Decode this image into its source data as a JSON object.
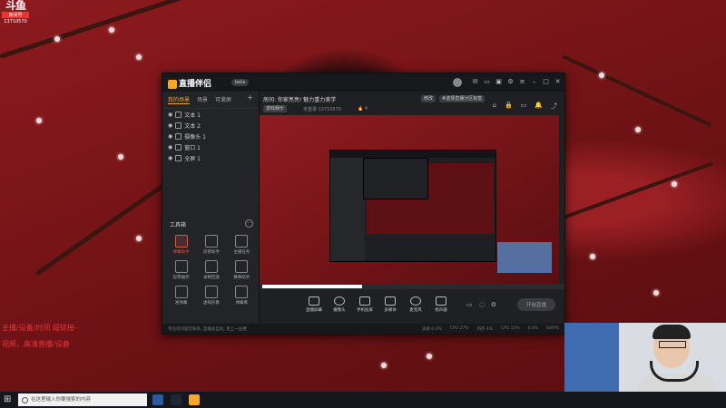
{
  "watermark": {
    "logo": "斗鱼",
    "tag": "房间号",
    "room": "13710570"
  },
  "overlay_red": {
    "line1": "主播/设备/时间 超链接-",
    "line2": "视频、高清直播/设备"
  },
  "app": {
    "title": "直播伴侣",
    "version_badge": "beta",
    "sidebar": {
      "tabs": [
        {
          "label": "我的场景"
        },
        {
          "label": "场景"
        },
        {
          "label": "可滚屏"
        }
      ],
      "add_label": "+",
      "layers": [
        {
          "label": "文本 1"
        },
        {
          "label": "文本 2"
        },
        {
          "label": "摄像头 1"
        },
        {
          "label": "窗口 1"
        },
        {
          "label": "全屏 1"
        }
      ],
      "tools_title": "工具箱",
      "tools_more": "···",
      "tools": [
        {
          "label": "弹幕助手",
          "hot": true
        },
        {
          "label": "房管助手"
        },
        {
          "label": "主播任务"
        },
        {
          "label": "投票抽奖"
        },
        {
          "label": "录制回放"
        },
        {
          "label": "赛事助手"
        },
        {
          "label": "发弹幕"
        },
        {
          "label": "虚拟形象"
        },
        {
          "label": "弹幕库"
        }
      ]
    },
    "infobar": {
      "title": "房间: 你家亮亮! 魅力重力美学",
      "edit_btn": "修改",
      "subtitle": "未登录 13710570",
      "tag_btn": "#选择直播分区标签",
      "category_btn": "游戏娱乐",
      "viewers": "4"
    },
    "controls": [
      {
        "label": "直播屏幕"
      },
      {
        "label": "摄像头"
      },
      {
        "label": "手机投屏"
      },
      {
        "label": "多媒体"
      },
      {
        "label": "麦克风"
      },
      {
        "label": "扬声器"
      }
    ],
    "start_button": "开始直播",
    "status": {
      "notice": "有任何问题可联系, 直播会自动, 更上一层楼",
      "stats": [
        "丢帧 0.0%",
        "CPU 27%",
        "内存 4%",
        "CPU 13%",
        "0.0%",
        "60FPS"
      ]
    }
  },
  "taskbar": {
    "search_placeholder": "在这里输入你要搜索的内容"
  },
  "colors": {
    "accent": "#f7a825",
    "hot": "#f04b3a",
    "wallpaper": "#7a1417"
  }
}
